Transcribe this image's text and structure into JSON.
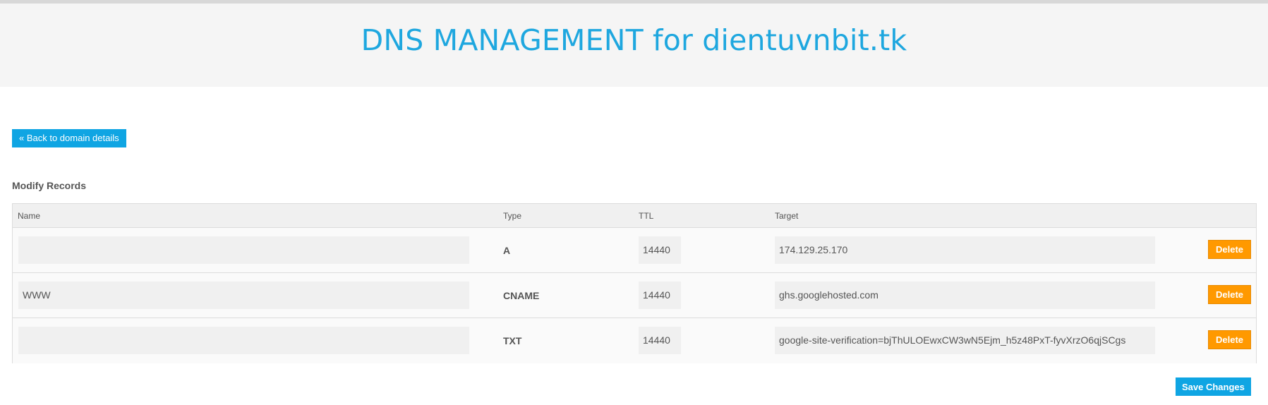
{
  "header": {
    "title": "DNS MANAGEMENT for dientuvnbit.tk"
  },
  "back_button": {
    "label": "« Back to domain details"
  },
  "section": {
    "title": "Modify Records"
  },
  "table": {
    "columns": {
      "name": "Name",
      "type": "Type",
      "ttl": "TTL",
      "target": "Target"
    },
    "rows": [
      {
        "name": "",
        "type": "A",
        "ttl": "14440",
        "target": "174.129.25.170",
        "delete_label": "Delete"
      },
      {
        "name": "WWW",
        "type": "CNAME",
        "ttl": "14440",
        "target": "ghs.googlehosted.com",
        "delete_label": "Delete"
      },
      {
        "name": "",
        "type": "TXT",
        "ttl": "14440",
        "target": "google-site-verification=bjThULOEwxCW3wN5Ejm_h5z48PxT-fyvXrzO6qjSCgs",
        "delete_label": "Delete"
      }
    ]
  },
  "save_button": {
    "label": "Save Changes"
  },
  "colors": {
    "accent_blue": "#0fa5e3",
    "title_blue": "#1ea7df",
    "delete_orange": "#ff9900"
  }
}
